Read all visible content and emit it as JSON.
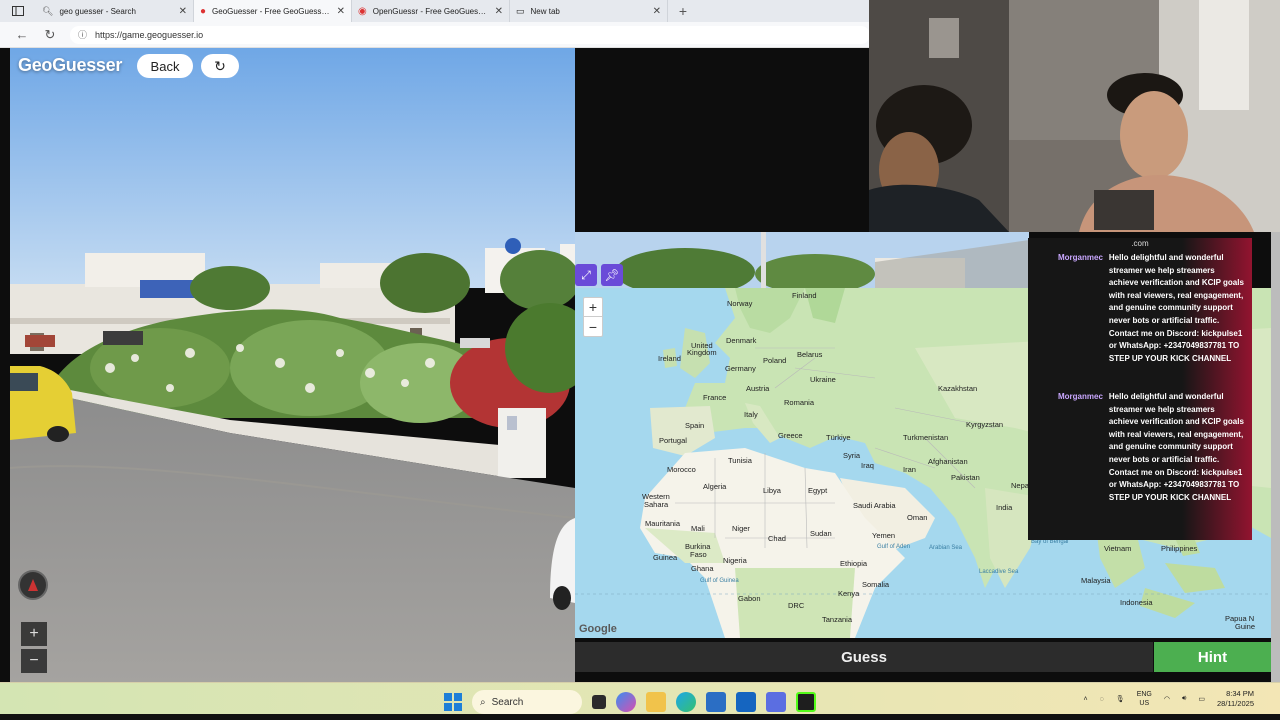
{
  "browser": {
    "tabs": [
      {
        "title": "geo guesser - Search",
        "icon": "search-icon",
        "active": false
      },
      {
        "title": "GeoGuesser - Free GeoGuessr Game",
        "icon": "map-pin-icon",
        "active": true
      },
      {
        "title": "OpenGuessr - Free GeoGuessr Alternative",
        "icon": "openguessr-icon",
        "active": false
      },
      {
        "title": "New tab",
        "icon": "newtab-icon",
        "active": false
      }
    ],
    "url": "https://game.geoguesser.io"
  },
  "game": {
    "logo": "GeoGuesser",
    "back_label": "Back",
    "guess_label": "Guess",
    "hint_label": "Hint"
  },
  "map": {
    "google_mark": "Google",
    "labels": [
      {
        "text": "Finland"
      },
      {
        "text": "Norway"
      },
      {
        "text": "Denmark"
      },
      {
        "text": "United"
      },
      {
        "text": "Kingdom"
      },
      {
        "text": "Ireland"
      },
      {
        "text": "Poland"
      },
      {
        "text": "Belarus"
      },
      {
        "text": "Germany"
      },
      {
        "text": "Ukraine"
      },
      {
        "text": "Austria"
      },
      {
        "text": "France"
      },
      {
        "text": "Romania"
      },
      {
        "text": "Kazakhstan"
      },
      {
        "text": "Italy"
      },
      {
        "text": "Spain"
      },
      {
        "text": "Kyrgyzstan"
      },
      {
        "text": "Portugal"
      },
      {
        "text": "Greece"
      },
      {
        "text": "Türkiye"
      },
      {
        "text": "Turkmenistan"
      },
      {
        "text": "Tunisia"
      },
      {
        "text": "Syria"
      },
      {
        "text": "Afghanistan"
      },
      {
        "text": "Iraq"
      },
      {
        "text": "Morocco"
      },
      {
        "text": "Iran"
      },
      {
        "text": "Pakistan"
      },
      {
        "text": "Algeria"
      },
      {
        "text": "Libya"
      },
      {
        "text": "Egypt"
      },
      {
        "text": "Nepal"
      },
      {
        "text": "Western"
      },
      {
        "text": "Sahara"
      },
      {
        "text": "Saudi Arabia"
      },
      {
        "text": "Oman"
      },
      {
        "text": "India"
      },
      {
        "text": "Mauritania"
      },
      {
        "text": "Mali"
      },
      {
        "text": "Niger"
      },
      {
        "text": "Sudan"
      },
      {
        "text": "Chad"
      },
      {
        "text": "Yemen"
      },
      {
        "text": "Burkina"
      },
      {
        "text": "Faso"
      },
      {
        "text": "Guinea"
      },
      {
        "text": "Nigeria"
      },
      {
        "text": "Ghana"
      },
      {
        "text": "Ethiopia"
      },
      {
        "text": "Somalia"
      },
      {
        "text": "Gabon"
      },
      {
        "text": "Kenya"
      },
      {
        "text": "DRC"
      },
      {
        "text": "Tanzania"
      },
      {
        "text": "Vietnam"
      },
      {
        "text": "Philippines"
      },
      {
        "text": "Malaysia"
      },
      {
        "text": "Indonesia"
      },
      {
        "text": "Papua N"
      },
      {
        "text": "Guine"
      },
      {
        "text": "Arabian Sea"
      },
      {
        "text": "Bay of Bengal"
      },
      {
        "text": "Laccadive Sea"
      },
      {
        "text": "Gulf of Guinea"
      },
      {
        "text": "Gulf of Aden"
      }
    ]
  },
  "chat": {
    "top_fragment": ".com",
    "messages": [
      {
        "user": "Morganmec",
        "text": "Hello delightful and wonderful streamer we help streamers achieve verification and KCIP goals with real viewers, real engagement, and genuine community support never bots or artificial traffic. Contact me on Discord: kickpulse1 or WhatsApp: +2347049837781 TO STEP UP YOUR KICK CHANNEL"
      },
      {
        "user": "Morganmec",
        "text": "Hello delightful and wonderful streamer we help streamers achieve verification and KCIP goals with real viewers, real engagement, and genuine community support never bots or artificial traffic. Contact me on Discord: kickpulse1 or WhatsApp: +2347049837781 TO STEP UP YOUR KICK CHANNEL"
      }
    ]
  },
  "taskbar": {
    "search_label": "Search",
    "lang_line1": "ENG",
    "lang_line2": "US",
    "time": "8:34 PM",
    "date": "28/11/2025"
  },
  "colors": {
    "accent_purple": "#6a4bd8",
    "hint_green": "#4caf50",
    "chat_user": "#c9a7ff",
    "chat_accent": "#a01432"
  }
}
